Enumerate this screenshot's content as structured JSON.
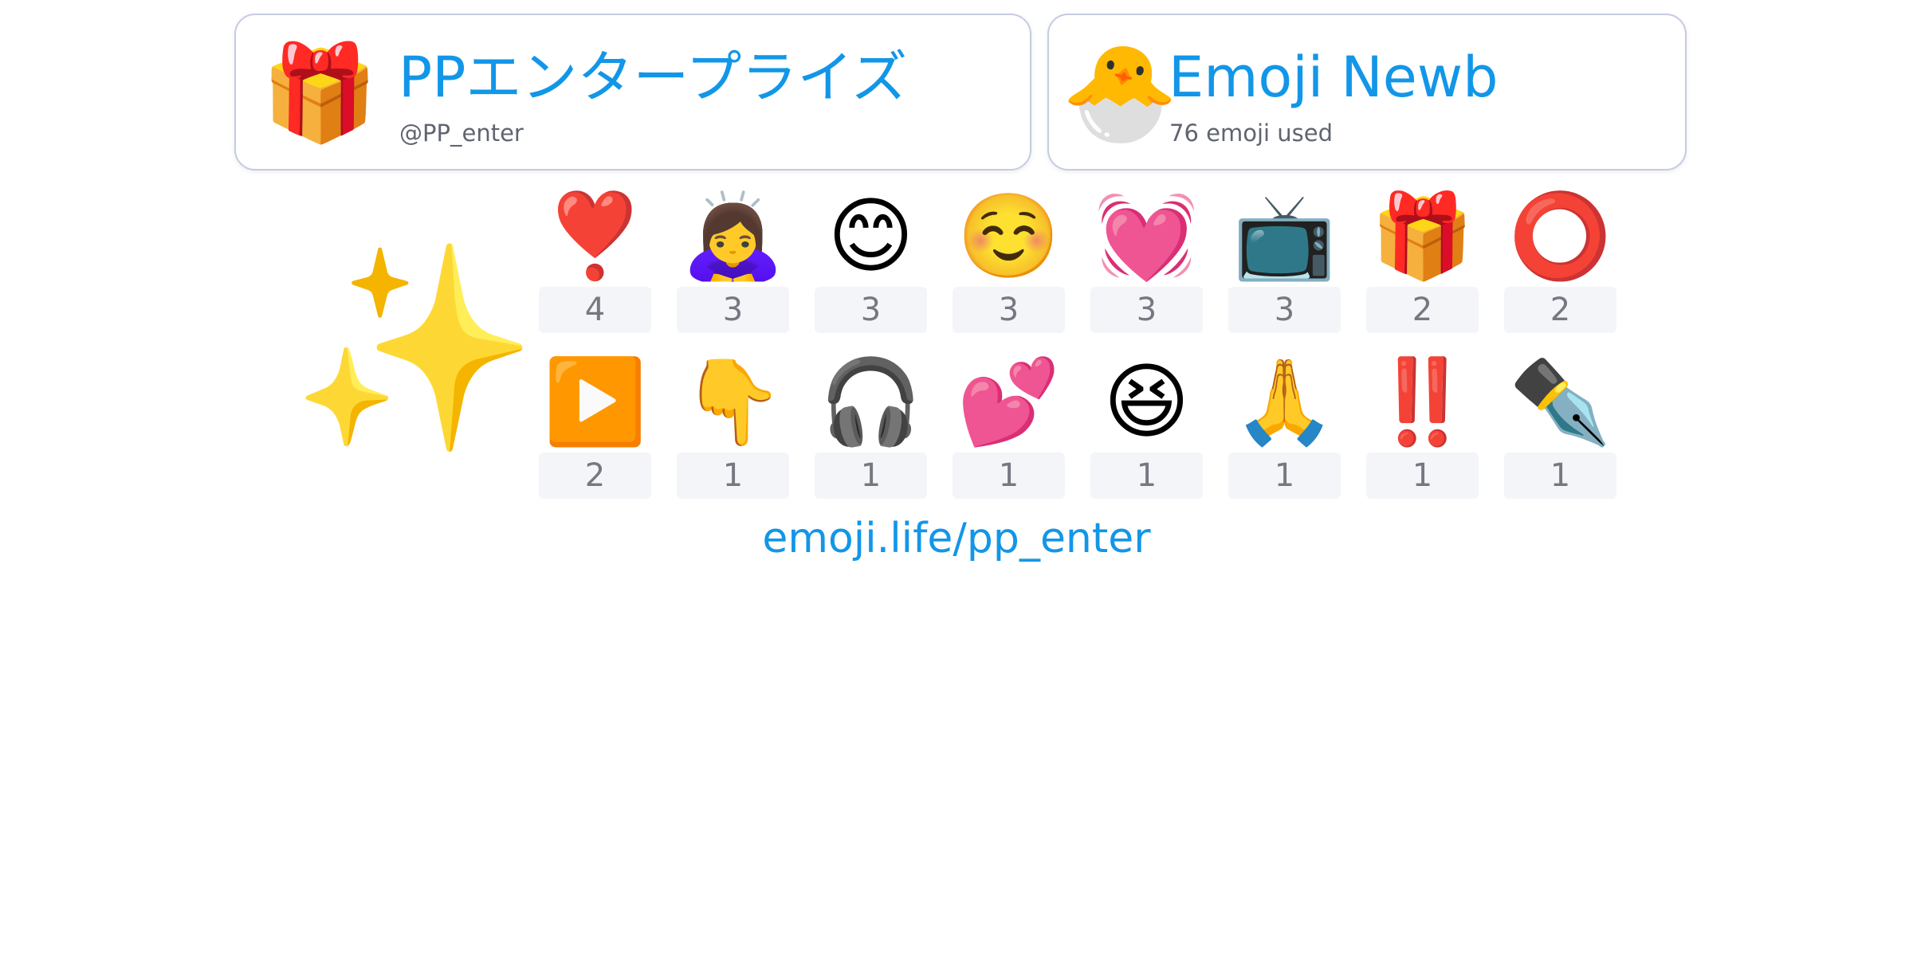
{
  "profile": {
    "name": "PPエンタープライズ",
    "handle": "@PP_enter",
    "avatar": "🎁",
    "avatar_icon_name": "pink-gift-box-avatar-icon"
  },
  "badge": {
    "title": "Emoji Newb",
    "subtitle": "76 emoji used",
    "icon": "🐣",
    "icon_name": "hatching-chick-icon"
  },
  "featured": {
    "emoji": "✨",
    "icon_name": "sparkles-icon"
  },
  "emoji_stats": [
    {
      "emoji": "❣️",
      "name": "heart-exclamation-icon",
      "count": "4"
    },
    {
      "emoji": "🙇‍♀️",
      "name": "woman-bowing-icon",
      "count": "3"
    },
    {
      "emoji": "😊",
      "name": "smiling-face-with-smiling-eyes-icon",
      "count": "3"
    },
    {
      "emoji": "☺️",
      "name": "smiling-face-icon",
      "count": "3"
    },
    {
      "emoji": "💓",
      "name": "beating-heart-icon",
      "count": "3"
    },
    {
      "emoji": "📺",
      "name": "television-icon",
      "count": "3"
    },
    {
      "emoji": "🎁",
      "name": "wrapped-gift-icon",
      "count": "2"
    },
    {
      "emoji": "⭕",
      "name": "hollow-red-circle-icon",
      "count": "2"
    },
    {
      "emoji": "▶️",
      "name": "play-button-icon",
      "count": "2"
    },
    {
      "emoji": "👇",
      "name": "backhand-index-pointing-down-icon",
      "count": "1"
    },
    {
      "emoji": "🎧",
      "name": "headphone-icon",
      "count": "1"
    },
    {
      "emoji": "💕",
      "name": "two-hearts-icon",
      "count": "1"
    },
    {
      "emoji": "😆",
      "name": "grinning-squinting-face-icon",
      "count": "1"
    },
    {
      "emoji": "🙏",
      "name": "folded-hands-icon",
      "count": "1"
    },
    {
      "emoji": "‼️",
      "name": "double-exclamation-mark-icon",
      "count": "1"
    },
    {
      "emoji": "✒️",
      "name": "black-nib-icon",
      "count": "1"
    }
  ],
  "footer": {
    "link_text": "emoji.life/pp_enter"
  },
  "colors": {
    "accent": "#1296e8",
    "muted_text": "#5f6470",
    "count_text": "#757881",
    "count_bg": "#f4f5f8",
    "card_border": "#c5cce0"
  }
}
